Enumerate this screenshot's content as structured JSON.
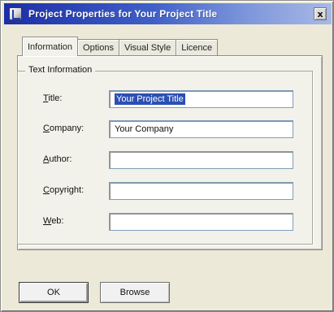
{
  "window": {
    "title": "Project Properties for Your Project Title",
    "close_label": "x"
  },
  "tabs": [
    {
      "label": "Information",
      "active": true
    },
    {
      "label": "Options",
      "active": false
    },
    {
      "label": "Visual Style",
      "active": false
    },
    {
      "label": "Licence",
      "active": false
    }
  ],
  "group": {
    "title": "Text Information"
  },
  "fields": {
    "title": {
      "label_prefix": "",
      "label_u": "T",
      "label_rest": "itle:",
      "value": "Your Project Title",
      "selected": true
    },
    "company": {
      "label_prefix": "",
      "label_u": "C",
      "label_rest": "ompany:",
      "value": "Your Company",
      "selected": false
    },
    "author": {
      "label_prefix": "",
      "label_u": "A",
      "label_rest": "uthor:",
      "value": "",
      "selected": false
    },
    "copyright": {
      "label_prefix": "",
      "label_u": "C",
      "label_rest": "opyright:",
      "value": "",
      "selected": false
    },
    "web": {
      "label_prefix": "",
      "label_u": "W",
      "label_rest": "eb:",
      "value": "",
      "selected": false
    }
  },
  "buttons": {
    "ok": "OK",
    "browse": "Browse"
  },
  "colors": {
    "titlebar_start": "#1c2ea6",
    "titlebar_end": "#a9b9e6",
    "selection": "#2b4fb3",
    "face": "#ece9d8"
  }
}
